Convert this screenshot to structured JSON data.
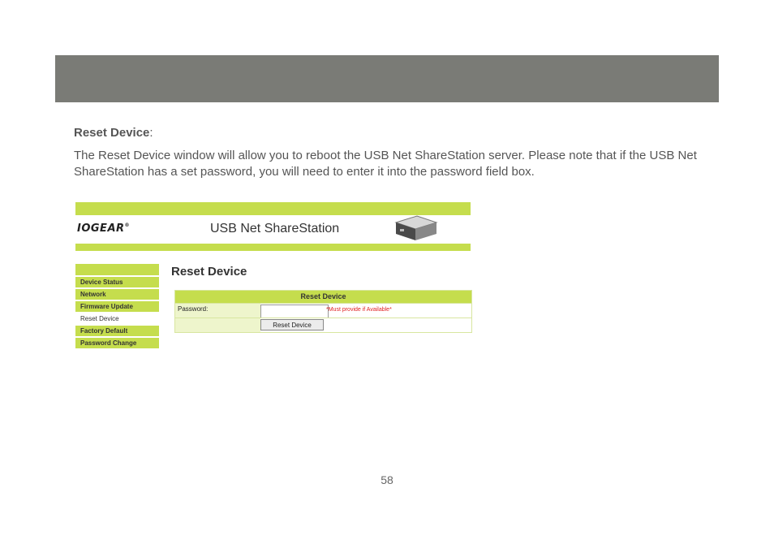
{
  "heading": {
    "title": "Reset Device",
    "suffix": ":"
  },
  "paragraph": "The Reset Device window will allow you to reboot the USB Net ShareStation server. Please note that if the USB Net ShareStation has a set password, you will need to enter it into the password field box.",
  "screenshot": {
    "logo": "IOGEAR",
    "logo_mark": "®",
    "product": "USB Net ShareStation",
    "menu": [
      {
        "label": "Device Status"
      },
      {
        "label": "Network"
      },
      {
        "label": "Firmware Update"
      },
      {
        "label": "Reset Device"
      },
      {
        "label": "Factory Default"
      },
      {
        "label": "Password Change"
      }
    ],
    "active_menu": "Reset Device",
    "panel_title": "Reset Device",
    "table_header": "Reset Device",
    "password_label": "Password:",
    "password_value": "",
    "password_note": "*Must provide if Available*",
    "button_label": "Reset Device",
    "colors": {
      "accent": "#c5dd4d",
      "note": "#e02020"
    }
  },
  "page_number": "58"
}
